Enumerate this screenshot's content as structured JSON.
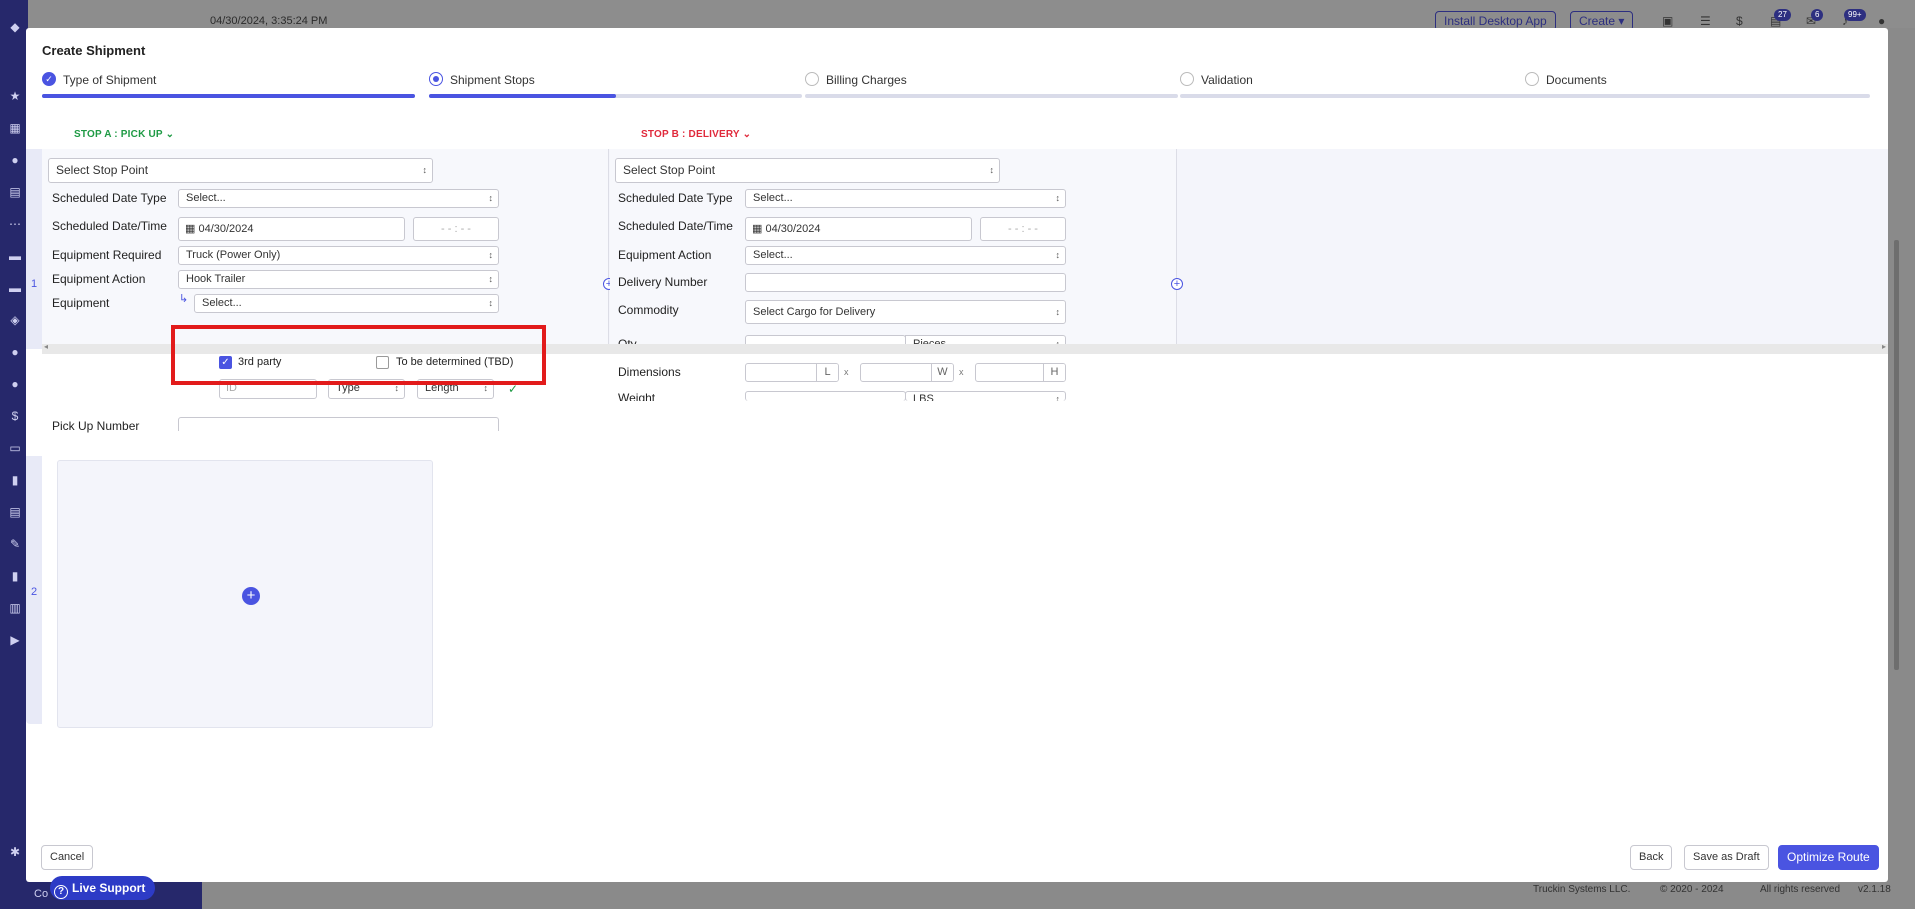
{
  "background": {
    "datetime": "04/30/2024, 3:35:24 PM",
    "install_label": "Install Desktop App",
    "create_label": "Create",
    "badges": [
      "27",
      "6",
      "99+"
    ],
    "footer_company": "Truckin Systems LLC.",
    "footer_copyright": "© 2020 - 2024",
    "footer_rights": "All rights reserved",
    "footer_version": "v2.1.18",
    "sidebar_bottom": "Co"
  },
  "modal": {
    "title": "Create Shipment",
    "steps": [
      {
        "label": "Type of Shipment",
        "state": "done",
        "progress": 1.0
      },
      {
        "label": "Shipment Stops",
        "state": "current",
        "progress": 0.5
      },
      {
        "label": "Billing Charges",
        "state": "todo",
        "progress": 0
      },
      {
        "label": "Validation",
        "state": "todo",
        "progress": 0
      },
      {
        "label": "Documents",
        "state": "todo",
        "progress": 0
      }
    ],
    "row_numbers": [
      "1",
      "2"
    ],
    "stop_a": {
      "header": "STOP A : PICK UP",
      "stop_point": "Select Stop Point",
      "scheduled_date_type_label": "Scheduled Date Type",
      "scheduled_date_type_value": "Select...",
      "scheduled_datetime_label": "Scheduled Date/Time",
      "date_value": "04/30/2024",
      "time_value": "- -   :   - -",
      "equipment_required_label": "Equipment Required",
      "equipment_required_value": "Truck (Power Only)",
      "equipment_action_label": "Equipment Action",
      "equipment_action_value": "Hook Trailer",
      "equipment_label": "Equipment",
      "equipment_value": "Select...",
      "third_party_label": "3rd party",
      "tbd_label": "To be determined (TBD)",
      "id_placeholder": "ID",
      "type_label": "Type",
      "length_label": "Length",
      "pickup_number_label": "Pick Up Number"
    },
    "stop_b": {
      "header": "STOP B : DELIVERY",
      "stop_point": "Select Stop Point",
      "scheduled_date_type_label": "Scheduled Date Type",
      "scheduled_date_type_value": "Select...",
      "scheduled_datetime_label": "Scheduled Date/Time",
      "date_value": "04/30/2024",
      "time_value": "- -   :   - -",
      "equipment_action_label": "Equipment Action",
      "equipment_action_value": "Select...",
      "delivery_number_label": "Delivery Number",
      "commodity_label": "Commodity",
      "commodity_value": "Select Cargo for Delivery",
      "qty_label": "Qty",
      "qty_unit": "Pieces",
      "dimensions_label": "Dimensions",
      "dim_l": "L",
      "dim_w": "W",
      "dim_h": "H",
      "dim_x": "x",
      "weight_label": "Weight",
      "weight_unit": "LBS"
    },
    "buttons": {
      "cancel": "Cancel",
      "back": "Back",
      "save_draft": "Save as Draft",
      "optimize": "Optimize Route"
    }
  },
  "live_support": {
    "label": "Live Support"
  },
  "colors": {
    "accent": "#4a54e1",
    "pickup": "#1e9a44",
    "delivery": "#e0293b",
    "highlight": "#e21b1b"
  }
}
